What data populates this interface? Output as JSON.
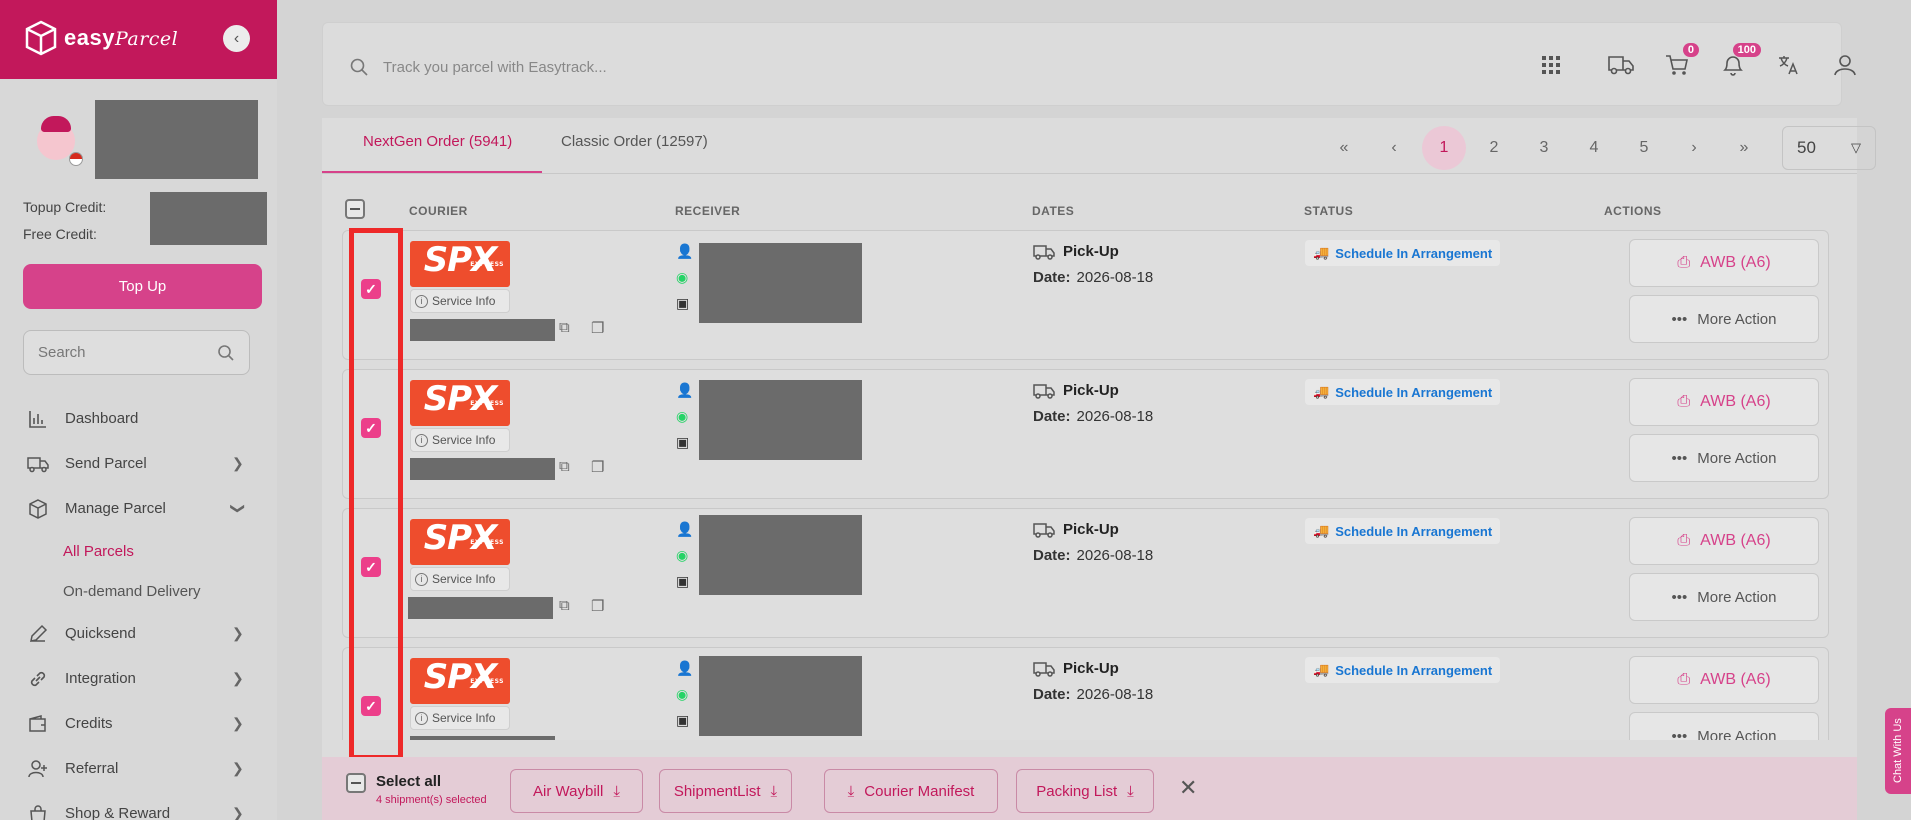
{
  "sidebar": {
    "brand_name": "easy",
    "brand_script": "Parcel",
    "topup_credit_label": "Topup Credit:",
    "free_credit_label": "Free Credit:",
    "topup_button": "Top Up",
    "search_placeholder": "Search",
    "nav": [
      {
        "label": "Dashboard",
        "icon": "chart-icon"
      },
      {
        "label": "Send Parcel",
        "icon": "truck-icon"
      },
      {
        "label": "Manage Parcel",
        "icon": "box-icon"
      },
      {
        "label": "All Parcels"
      },
      {
        "label": "On-demand Delivery"
      },
      {
        "label": "Quicksend",
        "icon": "pen-icon"
      },
      {
        "label": "Integration",
        "icon": "link-icon"
      },
      {
        "label": "Credits",
        "icon": "wallet-icon"
      },
      {
        "label": "Referral",
        "icon": "user-plus-icon"
      },
      {
        "label": "Shop & Reward",
        "icon": "bag-icon"
      }
    ]
  },
  "topbar": {
    "track_placeholder": "Track you parcel with Easytrack...",
    "cart_badge": "0",
    "notif_badge": "100"
  },
  "tabs": [
    {
      "label": "NextGen Order (5941)",
      "active": true
    },
    {
      "label": "Classic Order (12597)",
      "active": false
    }
  ],
  "pager": {
    "pages": [
      "1",
      "2",
      "3",
      "4",
      "5"
    ],
    "current": "1",
    "per_page": "50"
  },
  "table": {
    "headers": [
      "COURIER",
      "RECEIVER",
      "DATES",
      "STATUS",
      "ACTIONS"
    ],
    "rows": [
      {
        "courier": "SPX",
        "courier_sub": "EXPRESS",
        "service_info": "Service Info",
        "pickup_label": "Pick-Up",
        "date_label": "Date:",
        "date": "2026-08-18",
        "status": "Schedule In Arrangement",
        "awb": "AWB (A6)",
        "more": "More Action"
      },
      {
        "courier": "SPX",
        "courier_sub": "EXPRESS",
        "service_info": "Service Info",
        "pickup_label": "Pick-Up",
        "date_label": "Date:",
        "date": "2026-08-18",
        "status": "Schedule In Arrangement",
        "awb": "AWB (A6)",
        "more": "More Action"
      },
      {
        "courier": "SPX",
        "courier_sub": "EXPRESS",
        "service_info": "Service Info",
        "pickup_label": "Pick-Up",
        "date_label": "Date:",
        "date": "2026-08-18",
        "status": "Schedule In Arrangement",
        "awb": "AWB (A6)",
        "more": "More Action"
      },
      {
        "courier": "SPX",
        "courier_sub": "EXPRESS",
        "service_info": "Service Info",
        "pickup_label": "Pick-Up",
        "date_label": "Date:",
        "date": "2026-08-18",
        "status": "Schedule In Arrangement",
        "awb": "AWB (A6)",
        "more": "More Action"
      }
    ]
  },
  "bottombar": {
    "select_all": "Select all",
    "selected_count": "4 shipment(s) selected",
    "buttons": [
      "Air Waybill",
      "ShipmentList",
      "Courier Manifest",
      "Packing List"
    ]
  },
  "chat": "Chat With Us",
  "colors": {
    "brand": "#c2185b",
    "accent": "#d6428a",
    "status": "#1976d2",
    "highlight": "#ee2929"
  }
}
